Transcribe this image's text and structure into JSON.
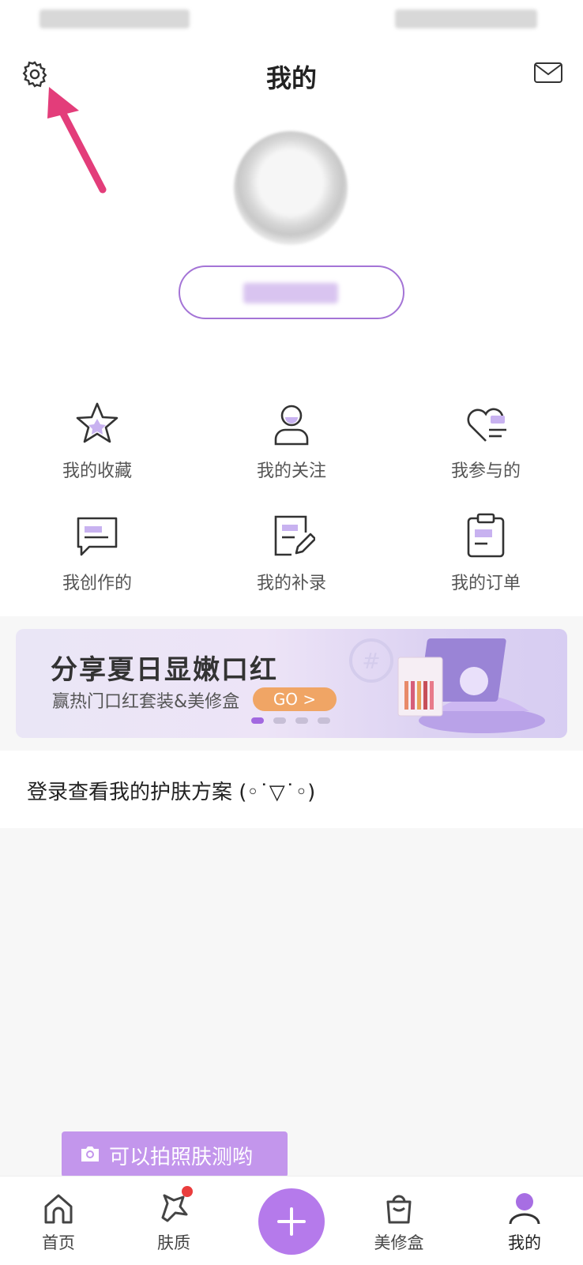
{
  "header": {
    "title": "我的"
  },
  "profile": {},
  "menu": [
    {
      "label": "我的收藏",
      "icon": "star-icon"
    },
    {
      "label": "我的关注",
      "icon": "person-icon"
    },
    {
      "label": "我参与的",
      "icon": "heart-list-icon"
    },
    {
      "label": "我创作的",
      "icon": "chat-icon"
    },
    {
      "label": "我的补录",
      "icon": "edit-doc-icon"
    },
    {
      "label": "我的订单",
      "icon": "clipboard-icon"
    }
  ],
  "banner": {
    "title": "分享夏日显嫩口红",
    "subtitle": "赢热门口红套装&美修盒",
    "cta": "GO >",
    "page_count": 4,
    "active_page": 1
  },
  "plan": {
    "text": "登录查看我的护肤方案 (◦˙▽˙◦)"
  },
  "tooltip": {
    "text": "可以拍照肤测哟"
  },
  "tabbar": {
    "items": [
      {
        "label": "首页",
        "icon": "home-icon"
      },
      {
        "label": "肤质",
        "icon": "skin-icon"
      },
      {
        "label": "",
        "icon": "plus-icon"
      },
      {
        "label": "美修盒",
        "icon": "bag-icon"
      },
      {
        "label": "我的",
        "icon": "profile-icon"
      }
    ]
  },
  "colors": {
    "accent": "#b57aeb",
    "annotation": "#e33d7a",
    "cta": "#f0a565"
  }
}
